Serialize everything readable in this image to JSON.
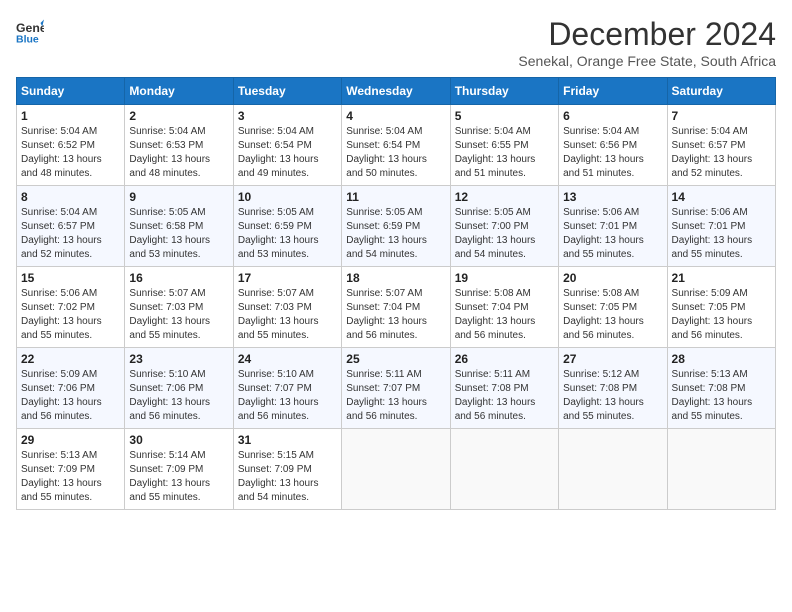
{
  "header": {
    "logo_line1": "General",
    "logo_line2": "Blue",
    "month_title": "December 2024",
    "subtitle": "Senekal, Orange Free State, South Africa"
  },
  "weekdays": [
    "Sunday",
    "Monday",
    "Tuesday",
    "Wednesday",
    "Thursday",
    "Friday",
    "Saturday"
  ],
  "weeks": [
    [
      {
        "day": "1",
        "sunrise": "5:04 AM",
        "sunset": "6:52 PM",
        "daylight": "13 hours and 48 minutes."
      },
      {
        "day": "2",
        "sunrise": "5:04 AM",
        "sunset": "6:53 PM",
        "daylight": "13 hours and 48 minutes."
      },
      {
        "day": "3",
        "sunrise": "5:04 AM",
        "sunset": "6:54 PM",
        "daylight": "13 hours and 49 minutes."
      },
      {
        "day": "4",
        "sunrise": "5:04 AM",
        "sunset": "6:54 PM",
        "daylight": "13 hours and 50 minutes."
      },
      {
        "day": "5",
        "sunrise": "5:04 AM",
        "sunset": "6:55 PM",
        "daylight": "13 hours and 51 minutes."
      },
      {
        "day": "6",
        "sunrise": "5:04 AM",
        "sunset": "6:56 PM",
        "daylight": "13 hours and 51 minutes."
      },
      {
        "day": "7",
        "sunrise": "5:04 AM",
        "sunset": "6:57 PM",
        "daylight": "13 hours and 52 minutes."
      }
    ],
    [
      {
        "day": "8",
        "sunrise": "5:04 AM",
        "sunset": "6:57 PM",
        "daylight": "13 hours and 52 minutes."
      },
      {
        "day": "9",
        "sunrise": "5:05 AM",
        "sunset": "6:58 PM",
        "daylight": "13 hours and 53 minutes."
      },
      {
        "day": "10",
        "sunrise": "5:05 AM",
        "sunset": "6:59 PM",
        "daylight": "13 hours and 53 minutes."
      },
      {
        "day": "11",
        "sunrise": "5:05 AM",
        "sunset": "6:59 PM",
        "daylight": "13 hours and 54 minutes."
      },
      {
        "day": "12",
        "sunrise": "5:05 AM",
        "sunset": "7:00 PM",
        "daylight": "13 hours and 54 minutes."
      },
      {
        "day": "13",
        "sunrise": "5:06 AM",
        "sunset": "7:01 PM",
        "daylight": "13 hours and 55 minutes."
      },
      {
        "day": "14",
        "sunrise": "5:06 AM",
        "sunset": "7:01 PM",
        "daylight": "13 hours and 55 minutes."
      }
    ],
    [
      {
        "day": "15",
        "sunrise": "5:06 AM",
        "sunset": "7:02 PM",
        "daylight": "13 hours and 55 minutes."
      },
      {
        "day": "16",
        "sunrise": "5:07 AM",
        "sunset": "7:03 PM",
        "daylight": "13 hours and 55 minutes."
      },
      {
        "day": "17",
        "sunrise": "5:07 AM",
        "sunset": "7:03 PM",
        "daylight": "13 hours and 55 minutes."
      },
      {
        "day": "18",
        "sunrise": "5:07 AM",
        "sunset": "7:04 PM",
        "daylight": "13 hours and 56 minutes."
      },
      {
        "day": "19",
        "sunrise": "5:08 AM",
        "sunset": "7:04 PM",
        "daylight": "13 hours and 56 minutes."
      },
      {
        "day": "20",
        "sunrise": "5:08 AM",
        "sunset": "7:05 PM",
        "daylight": "13 hours and 56 minutes."
      },
      {
        "day": "21",
        "sunrise": "5:09 AM",
        "sunset": "7:05 PM",
        "daylight": "13 hours and 56 minutes."
      }
    ],
    [
      {
        "day": "22",
        "sunrise": "5:09 AM",
        "sunset": "7:06 PM",
        "daylight": "13 hours and 56 minutes."
      },
      {
        "day": "23",
        "sunrise": "5:10 AM",
        "sunset": "7:06 PM",
        "daylight": "13 hours and 56 minutes."
      },
      {
        "day": "24",
        "sunrise": "5:10 AM",
        "sunset": "7:07 PM",
        "daylight": "13 hours and 56 minutes."
      },
      {
        "day": "25",
        "sunrise": "5:11 AM",
        "sunset": "7:07 PM",
        "daylight": "13 hours and 56 minutes."
      },
      {
        "day": "26",
        "sunrise": "5:11 AM",
        "sunset": "7:08 PM",
        "daylight": "13 hours and 56 minutes."
      },
      {
        "day": "27",
        "sunrise": "5:12 AM",
        "sunset": "7:08 PM",
        "daylight": "13 hours and 55 minutes."
      },
      {
        "day": "28",
        "sunrise": "5:13 AM",
        "sunset": "7:08 PM",
        "daylight": "13 hours and 55 minutes."
      }
    ],
    [
      {
        "day": "29",
        "sunrise": "5:13 AM",
        "sunset": "7:09 PM",
        "daylight": "13 hours and 55 minutes."
      },
      {
        "day": "30",
        "sunrise": "5:14 AM",
        "sunset": "7:09 PM",
        "daylight": "13 hours and 55 minutes."
      },
      {
        "day": "31",
        "sunrise": "5:15 AM",
        "sunset": "7:09 PM",
        "daylight": "13 hours and 54 minutes."
      },
      null,
      null,
      null,
      null
    ]
  ],
  "labels": {
    "sunrise": "Sunrise:",
    "sunset": "Sunset:",
    "daylight": "Daylight:"
  }
}
